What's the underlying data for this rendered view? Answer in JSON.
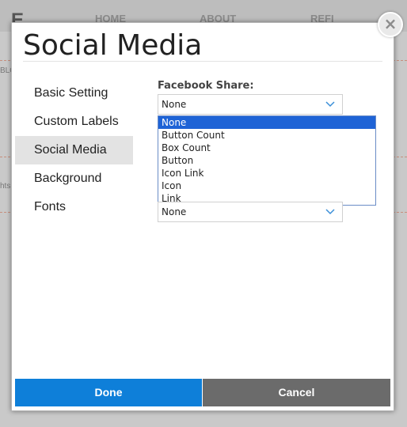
{
  "background_page": {
    "logo": "E",
    "nav": [
      "HOME",
      "ABOUT",
      "REFI"
    ],
    "side_text_1": "BLO",
    "side_text_2": "hts"
  },
  "modal": {
    "title": "Social Media",
    "close_icon": "close-icon",
    "nav_items": [
      {
        "label": "Basic Setting",
        "active": false
      },
      {
        "label": "Custom Labels",
        "active": false
      },
      {
        "label": "Social Media",
        "active": true
      },
      {
        "label": "Background",
        "active": false
      },
      {
        "label": "Fonts",
        "active": false
      }
    ],
    "facebook_share": {
      "label": "Facebook Share:",
      "value": "None",
      "options": [
        "None",
        "Button Count",
        "Box Count",
        "Button",
        "Icon Link",
        "Icon",
        "Link"
      ],
      "highlighted": "None"
    },
    "second_select": {
      "value": "None"
    },
    "buttons": {
      "done": "Done",
      "cancel": "Cancel"
    },
    "colors": {
      "done": "#0e7fd9",
      "cancel": "#6b6b6b",
      "highlight": "#1e63d6"
    }
  }
}
